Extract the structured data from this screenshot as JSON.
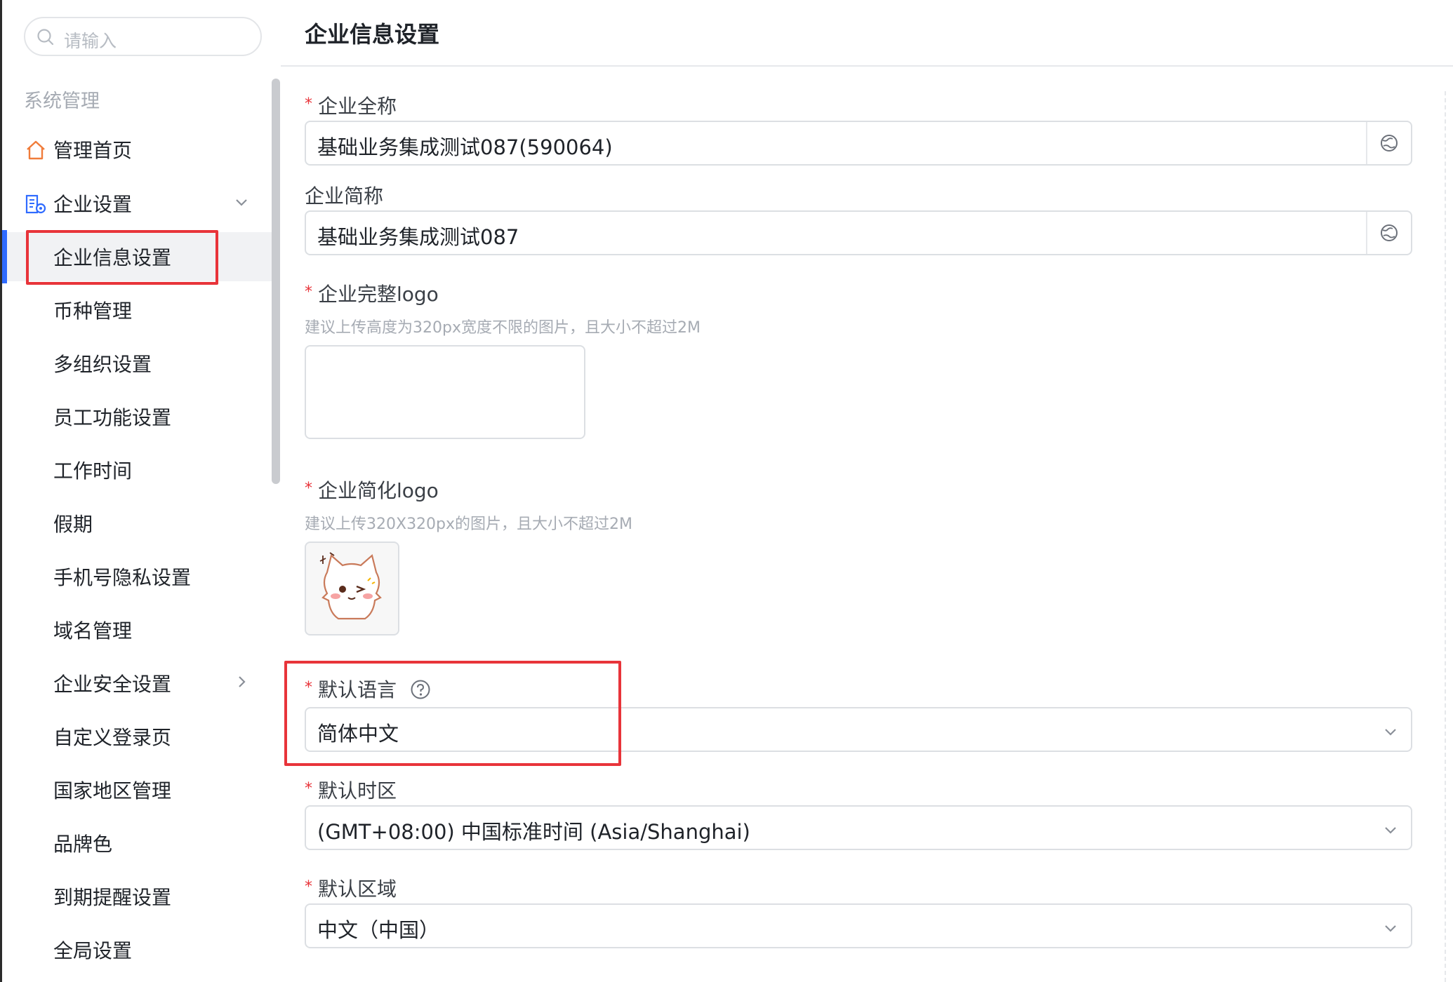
{
  "sidebar": {
    "search_placeholder": "请输入",
    "section_title": "系统管理",
    "items": [
      {
        "label": "管理首页",
        "icon": "home-icon"
      },
      {
        "label": "企业设置",
        "icon": "building-settings-icon"
      },
      {
        "label": "企业信息设置"
      },
      {
        "label": "币种管理"
      },
      {
        "label": "多组织设置"
      },
      {
        "label": "员工功能设置"
      },
      {
        "label": "工作时间"
      },
      {
        "label": "假期"
      },
      {
        "label": "手机号隐私设置"
      },
      {
        "label": "域名管理"
      },
      {
        "label": "企业安全设置"
      },
      {
        "label": "自定义登录页"
      },
      {
        "label": "国家地区管理"
      },
      {
        "label": "品牌色"
      },
      {
        "label": "到期提醒设置"
      },
      {
        "label": "全局设置"
      }
    ]
  },
  "main": {
    "title": "企业信息设置",
    "fields": {
      "full_name": {
        "label": "企业全称",
        "required": "*",
        "value": "基础业务集成测试087(590064)"
      },
      "short_name": {
        "label": "企业简称",
        "value": "基础业务集成测试087"
      },
      "full_logo": {
        "label": "企业完整logo",
        "required": "*",
        "hint": "建议上传高度为320px宽度不限的图片，且大小不超过2M"
      },
      "simple_logo": {
        "label": "企业简化logo",
        "required": "*",
        "hint": "建议上传320X320px的图片，且大小不超过2M"
      },
      "language": {
        "label": "默认语言",
        "required": "*",
        "value": "简体中文"
      },
      "timezone": {
        "label": "默认时区",
        "required": "*",
        "value": "(GMT+08:00) 中国标准时间 (Asia/Shanghai)"
      },
      "region": {
        "label": "默认区域",
        "required": "*",
        "value": "中文（中国）"
      }
    }
  },
  "colors": {
    "accent": "#2f6bff",
    "highlight": "#e8343a",
    "required": "#e8343a"
  }
}
